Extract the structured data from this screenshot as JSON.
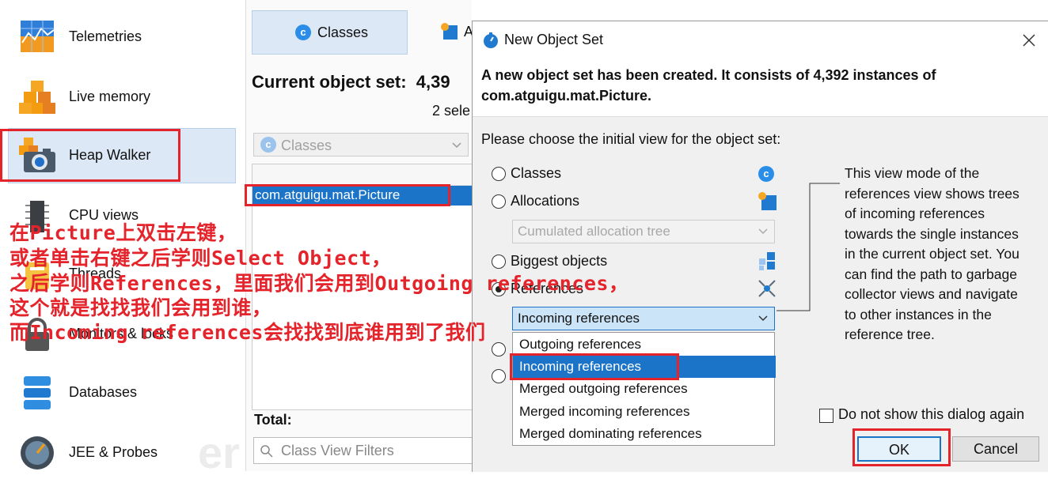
{
  "sidebar": {
    "items": [
      {
        "label": "Telemetries",
        "icon": "telemetry-chart-icon"
      },
      {
        "label": "Live memory",
        "icon": "live-memory-cubes-icon"
      },
      {
        "label": "Heap Walker",
        "icon": "camera-cubes-icon",
        "selected": true
      },
      {
        "label": "CPU views",
        "icon": "cpu-chip-icon"
      },
      {
        "label": "Threads",
        "icon": "threads-icon"
      },
      {
        "label": "Monitors & locks",
        "icon": "lock-icon"
      },
      {
        "label": "Databases",
        "icon": "database-icon"
      },
      {
        "label": "JEE & Probes",
        "icon": "gauge-icon"
      }
    ]
  },
  "middle": {
    "tab_classes": "Classes",
    "tab_allocations_partial": "A",
    "current_object_set": "Current object set:  4,39",
    "selected_partial": "2 sele",
    "view_select": "Classes",
    "selected_class": "com.atguigu.mat.Picture",
    "total_label": "Total:",
    "filter_placeholder": "Class View Filters"
  },
  "dialog": {
    "title": "New Object Set",
    "message_line1": "A new object set has been created. It consists of 4,392 instances of",
    "message_line2": "com.atguigu.mat.Picture.",
    "prompt": "Please choose the initial view for the object set:",
    "options": {
      "classes": "Classes",
      "allocations": "Allocations",
      "allocation_tree": "Cumulated allocation tree",
      "biggest": "Biggest objects",
      "references": "References"
    },
    "reference_select": "Incoming references",
    "dropdown_items": [
      "Outgoing references",
      "Incoming references",
      "Merged outgoing references",
      "Merged incoming references",
      "Merged dominating references"
    ],
    "description": [
      "This view mode of the",
      "references view shows trees",
      "of incoming references",
      "towards the single instances",
      "in the current object set. You",
      "can find the path to garbage",
      "collector views and navigate",
      "to other instances in the",
      "reference tree."
    ],
    "do_not_show": "Do not show this dialog again",
    "ok": "OK",
    "cancel": "Cancel"
  },
  "annotation": {
    "lines": [
      "在Picture上双击左键，",
      "或者单击右键之后学则Select Object，",
      "之后学则References，里面我们会用到Outgoing references，",
      "这个就是找找我们会用到谁，",
      "而Incoming references会找找到底谁用到了我们"
    ],
    "color": "#e4232b"
  },
  "colors": {
    "selection": "#1c74c9",
    "selected_nav_bg": "#dce8f6",
    "highlight_box": "#e4232b"
  }
}
